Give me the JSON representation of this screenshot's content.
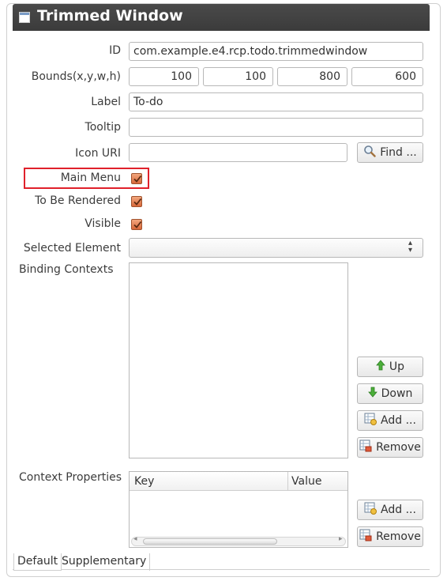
{
  "window": {
    "title": "Trimmed Window"
  },
  "fields": {
    "id_label": "ID",
    "id_value": "com.example.e4.rcp.todo.trimmedwindow",
    "bounds_label": "Bounds(x,y,w,h)",
    "bounds_x": "100",
    "bounds_y": "100",
    "bounds_w": "800",
    "bounds_h": "600",
    "label_label": "Label",
    "label_value": "To-do",
    "tooltip_label": "Tooltip",
    "tooltip_value": "",
    "icon_uri_label": "Icon URI",
    "icon_uri_value": "",
    "find_button": "Find ...",
    "main_menu_label": "Main Menu",
    "main_menu_checked": true,
    "to_be_rendered_label": "To Be Rendered",
    "to_be_rendered_checked": true,
    "visible_label": "Visible",
    "visible_checked": true,
    "selected_element_label": "Selected Element",
    "selected_element_value": ""
  },
  "binding_contexts": {
    "label": "Binding Contexts",
    "items": [],
    "up_button": "Up",
    "down_button": "Down",
    "add_button": "Add ...",
    "remove_button": "Remove"
  },
  "context_properties": {
    "label": "Context Properties",
    "columns": [
      "Key",
      "Value"
    ],
    "rows": [],
    "add_button": "Add ...",
    "remove_button": "Remove"
  },
  "tabs": [
    "Default",
    "Supplementary"
  ],
  "colors": {
    "highlight": "#e0212b",
    "titlebar": "#3f3f3f",
    "checkbox": "#e07a4a"
  }
}
